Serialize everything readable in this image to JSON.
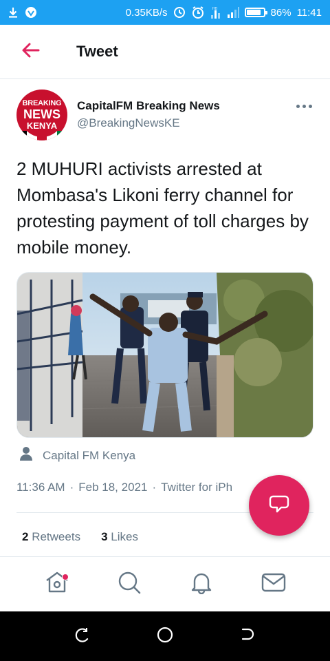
{
  "status_bar": {
    "speed": "0.35KB/s",
    "battery": "86%",
    "battery_level": 0.86,
    "time": "11:41",
    "background": "#1da1f2"
  },
  "header": {
    "title": "Tweet",
    "back_icon": "arrow-left-icon"
  },
  "tweet": {
    "author": {
      "name": "CapitalFM Breaking News",
      "handle": "@BreakingNewsKE",
      "avatar": {
        "line1": "BREAKING",
        "line2": "NEWS",
        "line3": "KENYA"
      }
    },
    "text": "2 MUHURI activists arrested at Mombasa's Likoni ferry channel for protesting payment of toll charges by mobile money.",
    "location": "Capital FM Kenya",
    "time": "11:36 AM",
    "date": "Feb 18, 2021",
    "source": "Twitter for iPh",
    "separator": "·",
    "retweets_count": "2",
    "retweets_label": "Retweets",
    "likes_count": "3",
    "likes_label": "Likes"
  },
  "fab": {
    "icon": "compose-reply-icon",
    "color": "#e0245e"
  },
  "bottom_nav": {
    "items": [
      {
        "name": "home",
        "icon": "home-icon",
        "has_notification_dot": true
      },
      {
        "name": "search",
        "icon": "search-icon"
      },
      {
        "name": "notifications",
        "icon": "bell-icon"
      },
      {
        "name": "messages",
        "icon": "mail-icon"
      }
    ]
  },
  "colors": {
    "accent": "#e0245e",
    "text_primary": "#14171a",
    "text_secondary": "#657786",
    "divider": "#e1e8ed"
  }
}
